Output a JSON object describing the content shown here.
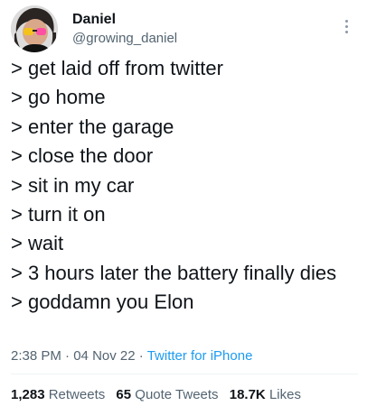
{
  "author": {
    "display_name": "Daniel",
    "handle": "@growing_daniel"
  },
  "tweet": {
    "lines": [
      "> get laid off from twitter",
      "> go home",
      "> enter the garage",
      "> close the door",
      "> sit in my car",
      "> turn it on",
      "> wait",
      "> 3 hours later the battery finally dies",
      "> goddamn you Elon"
    ]
  },
  "meta": {
    "time": "2:38 PM",
    "separator": "·",
    "date": "04 Nov 22",
    "source": "Twitter for iPhone"
  },
  "stats": {
    "retweets_count": "1,283",
    "retweets_label": "Retweets",
    "quotes_count": "65",
    "quotes_label": "Quote Tweets",
    "likes_count": "18.7K",
    "likes_label": "Likes"
  },
  "icons": {
    "more": "more-vertical-icon"
  },
  "colors": {
    "text": "#0f1419",
    "secondary": "#536471",
    "link": "#1d9bf0"
  }
}
